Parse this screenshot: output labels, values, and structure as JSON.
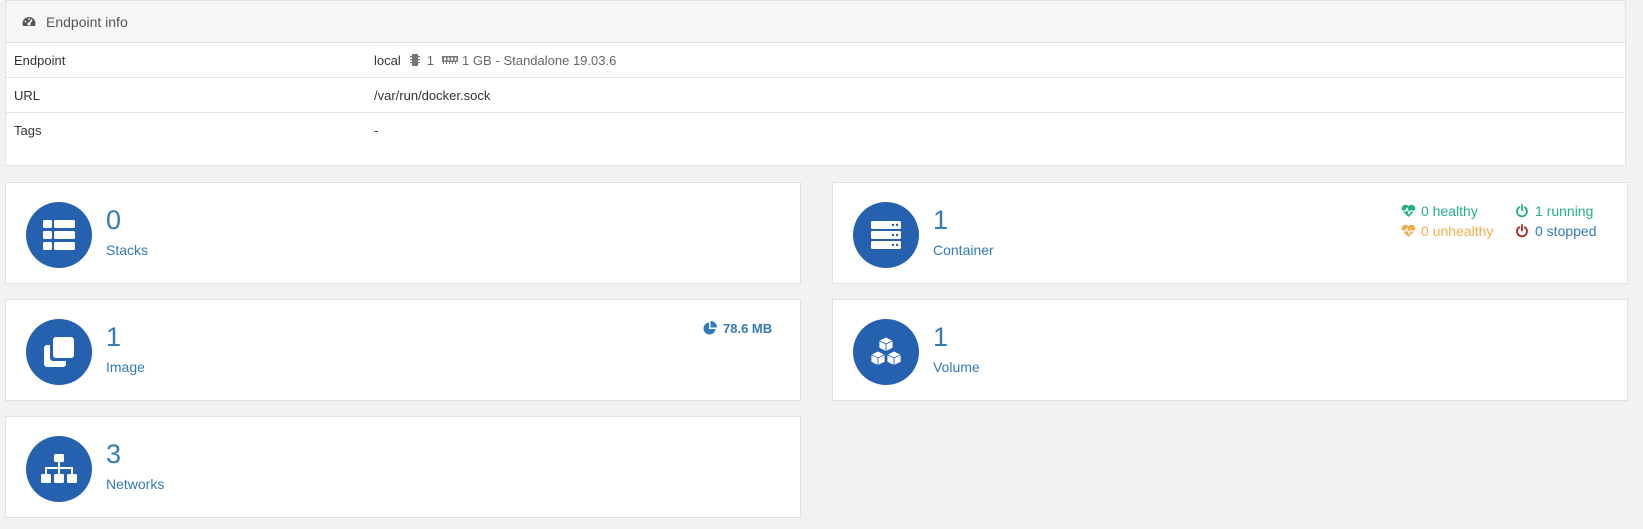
{
  "panel": {
    "title": "Endpoint info",
    "rows": {
      "endpoint": {
        "key": "Endpoint",
        "name": "local",
        "cpu": "1",
        "memory": "1 GB",
        "detail": "- Standalone 19.03.6"
      },
      "url": {
        "key": "URL",
        "value": "/var/run/docker.sock"
      },
      "tags": {
        "key": "Tags",
        "value": "-"
      }
    }
  },
  "cards": {
    "stacks": {
      "count": "0",
      "label": "Stacks",
      "icon": "th-list-icon"
    },
    "containers": {
      "count": "1",
      "label": "Container",
      "icon": "server-icon",
      "healthy": "0 healthy",
      "unhealthy": "0 unhealthy",
      "running": "1 running",
      "stopped": "0 stopped"
    },
    "images": {
      "count": "1",
      "label": "Image",
      "icon": "clone-icon",
      "size": "78.6 MB"
    },
    "volumes": {
      "count": "1",
      "label": "Volume",
      "icon": "cubes-icon"
    },
    "networks": {
      "count": "3",
      "label": "Networks",
      "icon": "sitemap-icon"
    }
  },
  "colors": {
    "accent": "#2661b0",
    "link": "#337ab7",
    "healthy": "#23ae89",
    "unhealthy": "#f0ad4e",
    "stopped": "#ae2323"
  }
}
